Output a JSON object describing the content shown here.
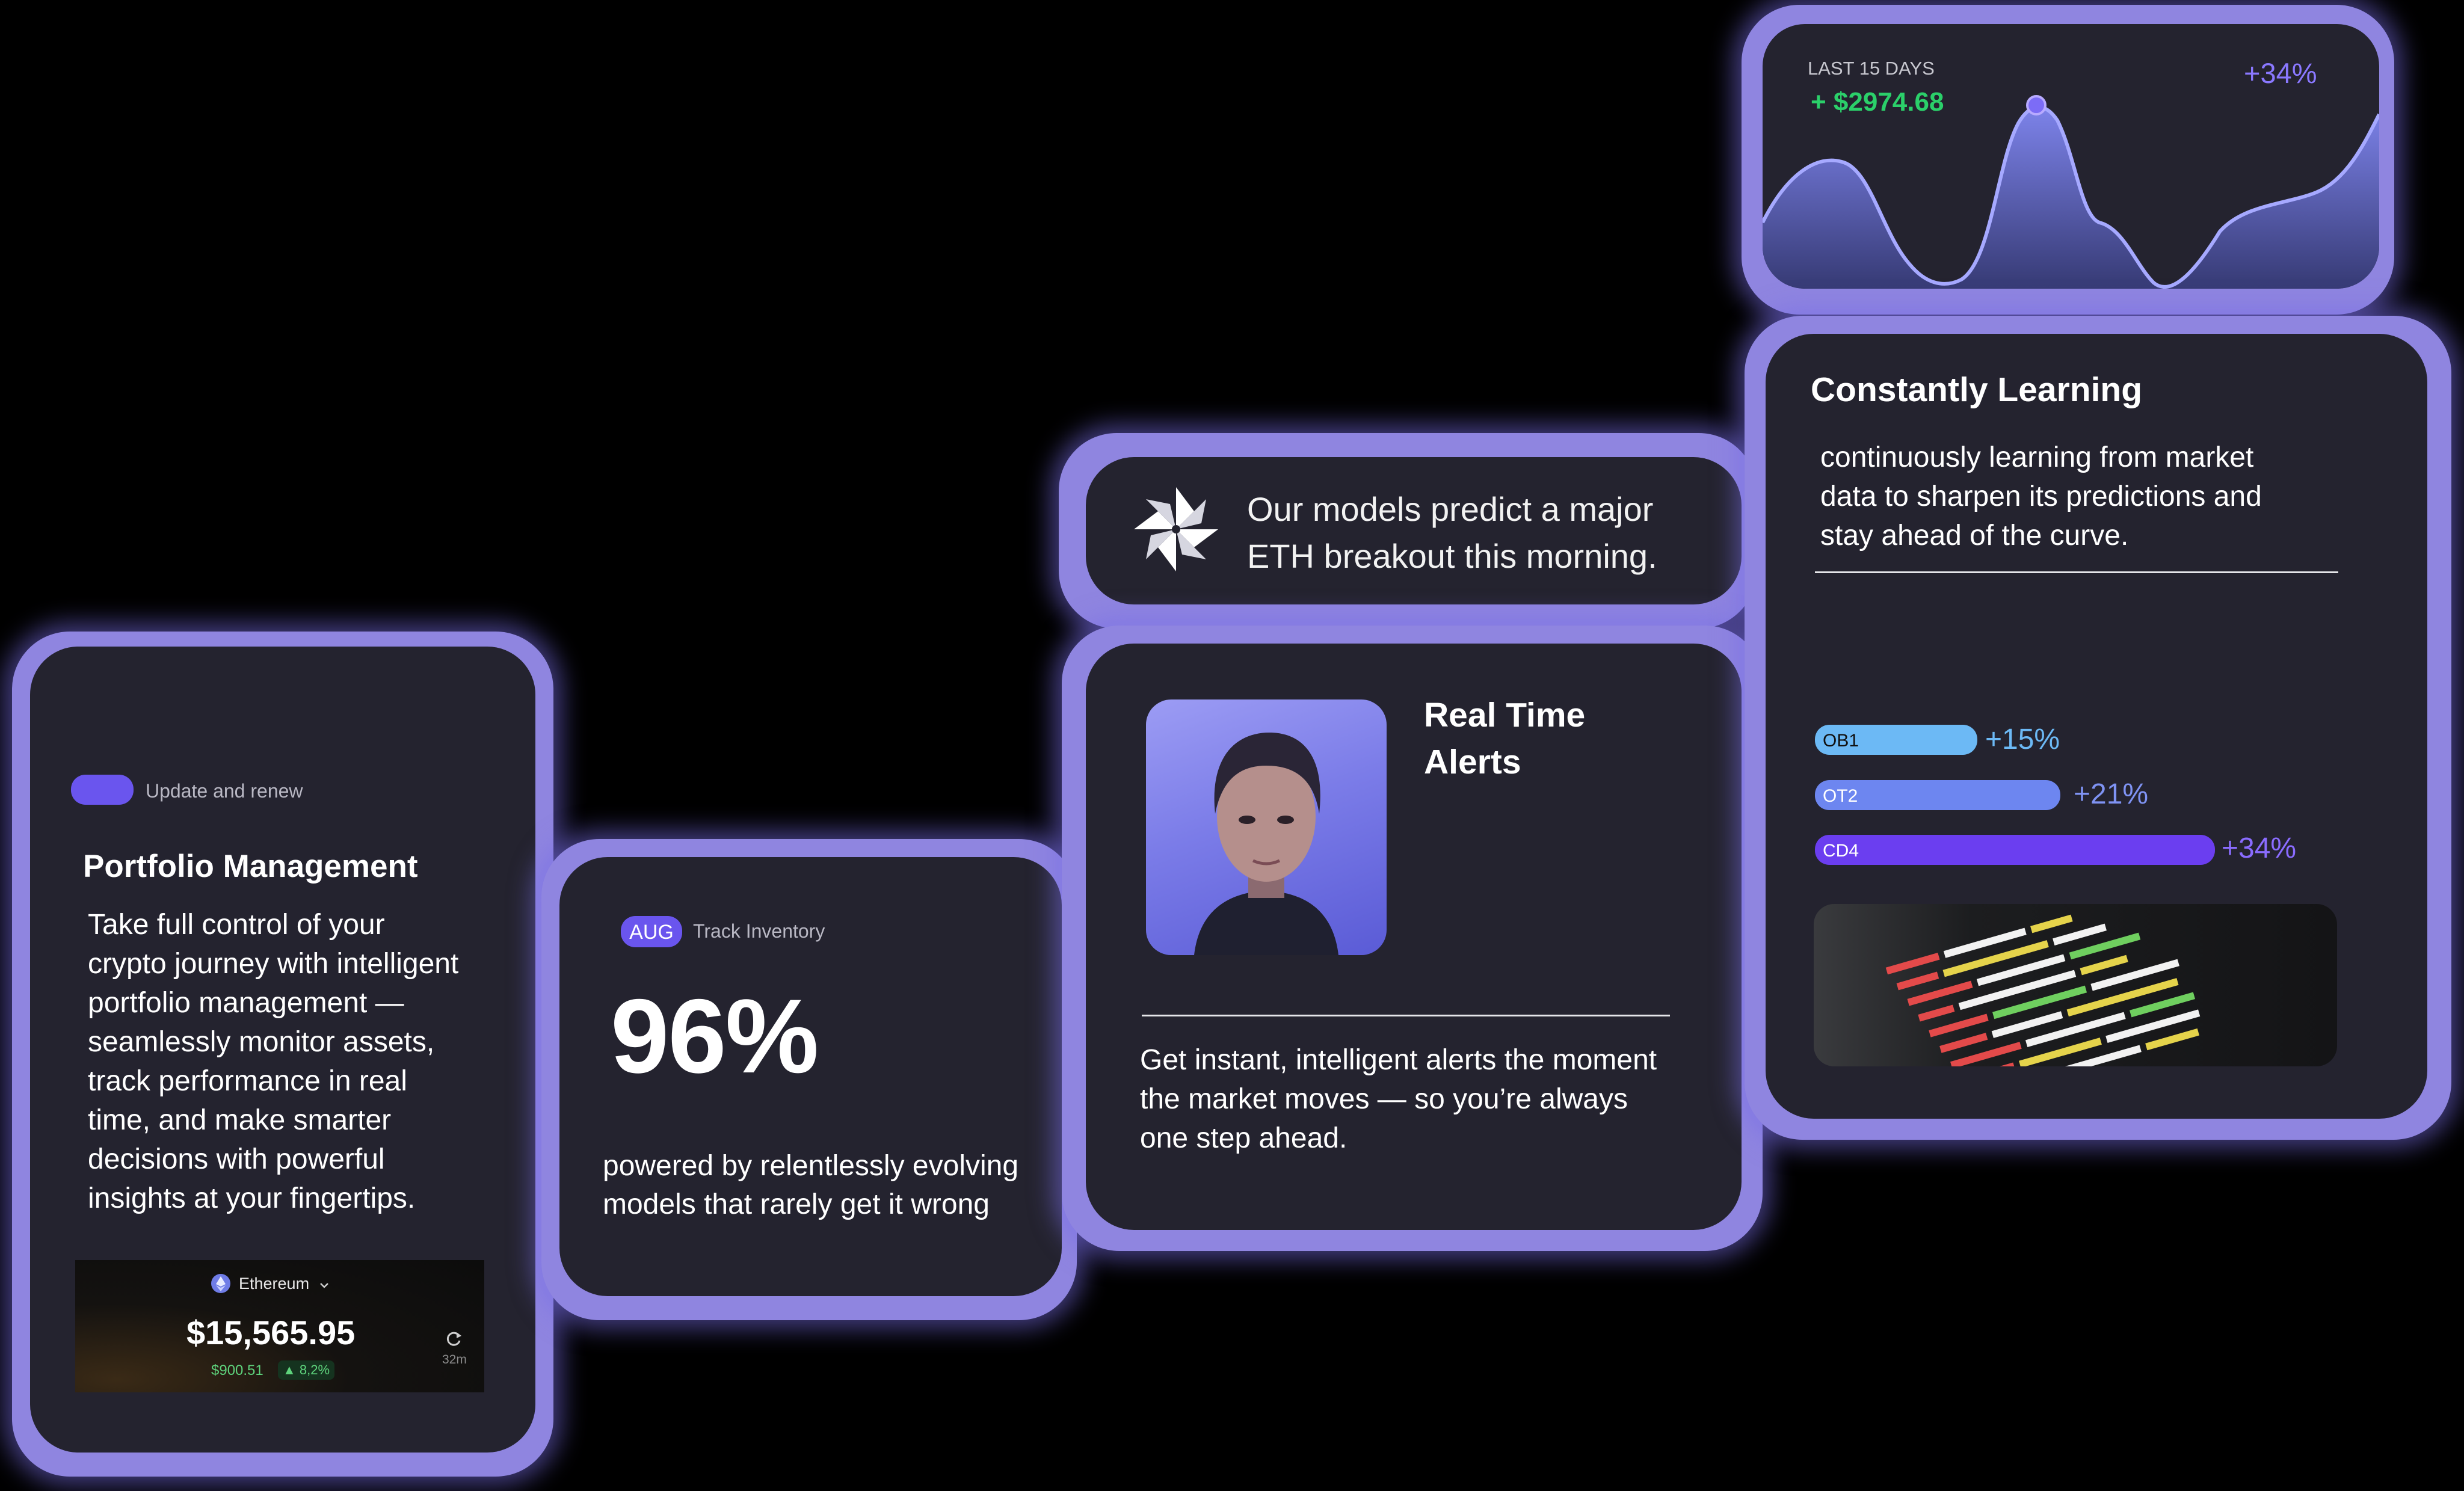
{
  "colors": {
    "accent": "#6a55ee",
    "card_bg": "#24232f",
    "glow": "#8f85e0",
    "positive": "#2bd06a",
    "bar_light": "#6cb9f5",
    "bar_mid": "#6d86f0",
    "bar_deep": "#6b3ef0"
  },
  "portfolio": {
    "badge_label": "Update and renew",
    "title": "Portfolio Management",
    "description_lines": [
      "Take full control of your",
      "crypto journey with intelligent",
      "portfolio management —",
      "seamlessly monitor assets,",
      "track performance in real",
      "time, and make smarter",
      "decisions with powerful",
      "insights at your fingertips."
    ],
    "wallet": {
      "asset": "Ethereum",
      "balance": "$15,565.95",
      "change_value": "$900.51",
      "change_percent": "▲ 8,2%",
      "time": "32m",
      "icon": "refresh-icon"
    }
  },
  "inventory": {
    "month_badge": "AUG",
    "label": "Track Inventory",
    "percent": "96%",
    "caption_lines": [
      "powered by relentlessly evolving",
      "models that rarely get it wrong"
    ]
  },
  "prediction": {
    "icon": "pinwheel-logo",
    "lines": [
      "Our models predict a major",
      "ETH breakout this morning."
    ]
  },
  "alerts": {
    "title_lines": [
      "Real Time",
      "Alerts"
    ],
    "description_lines": [
      "Get instant, intelligent alerts the moment",
      "the market moves — so you’re always",
      "one step ahead."
    ]
  },
  "earnings": {
    "period": "LAST 15 DAYS",
    "amount": "+ $2974.68",
    "change": "+34%"
  },
  "learning": {
    "title": "Constantly Learning",
    "description_lines": [
      "continuously learning from market",
      "data to sharpen its predictions and",
      "stay ahead of the curve."
    ],
    "bars": [
      {
        "label": "OB1",
        "value": "+15%",
        "fraction": 0.15
      },
      {
        "label": "OT2",
        "value": "+21%",
        "fraction": 0.21
      },
      {
        "label": "CD4",
        "value": "+34%",
        "fraction": 0.34
      }
    ]
  }
}
